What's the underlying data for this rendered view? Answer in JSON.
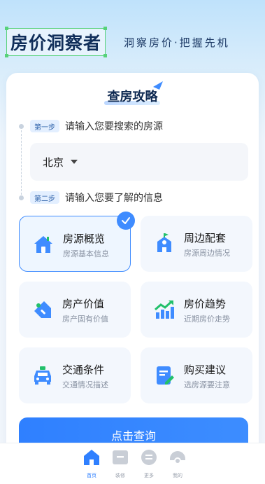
{
  "header": {
    "logo_text": "房价洞察者",
    "slogan": "洞察房价·把握先机"
  },
  "card": {
    "title": "查房攻略",
    "step1": {
      "badge": "第一步",
      "text": "请输入您要搜索的房源"
    },
    "city": {
      "value": "北京"
    },
    "step2": {
      "badge": "第二步",
      "text": "请输入您要了解的信息"
    },
    "options": [
      {
        "label": "房源概览",
        "sub": "房源基本信息",
        "icon": "house-icon",
        "selected": true
      },
      {
        "label": "周边配套",
        "sub": "房源周边情况",
        "icon": "school-icon",
        "selected": false
      },
      {
        "label": "房产价值",
        "sub": "房产固有价值",
        "icon": "price-tag-icon",
        "selected": false
      },
      {
        "label": "房价趋势",
        "sub": "近期房价走势",
        "icon": "trend-chart-icon",
        "selected": false
      },
      {
        "label": "交通条件",
        "sub": "交通情况描述",
        "icon": "car-icon",
        "selected": false
      },
      {
        "label": "购买建议",
        "sub": "选房源要注意",
        "icon": "edit-note-icon",
        "selected": false
      }
    ],
    "query_button": "点击查询"
  },
  "tabbar": {
    "items": [
      {
        "label": "首页",
        "active": true
      },
      {
        "label": "装修",
        "active": false
      },
      {
        "label": "更多",
        "active": false
      },
      {
        "label": "我的",
        "active": false
      }
    ]
  },
  "colors": {
    "accent": "#3f8cff",
    "logo_border": "#57d27a",
    "trend_green": "#22c06b"
  }
}
